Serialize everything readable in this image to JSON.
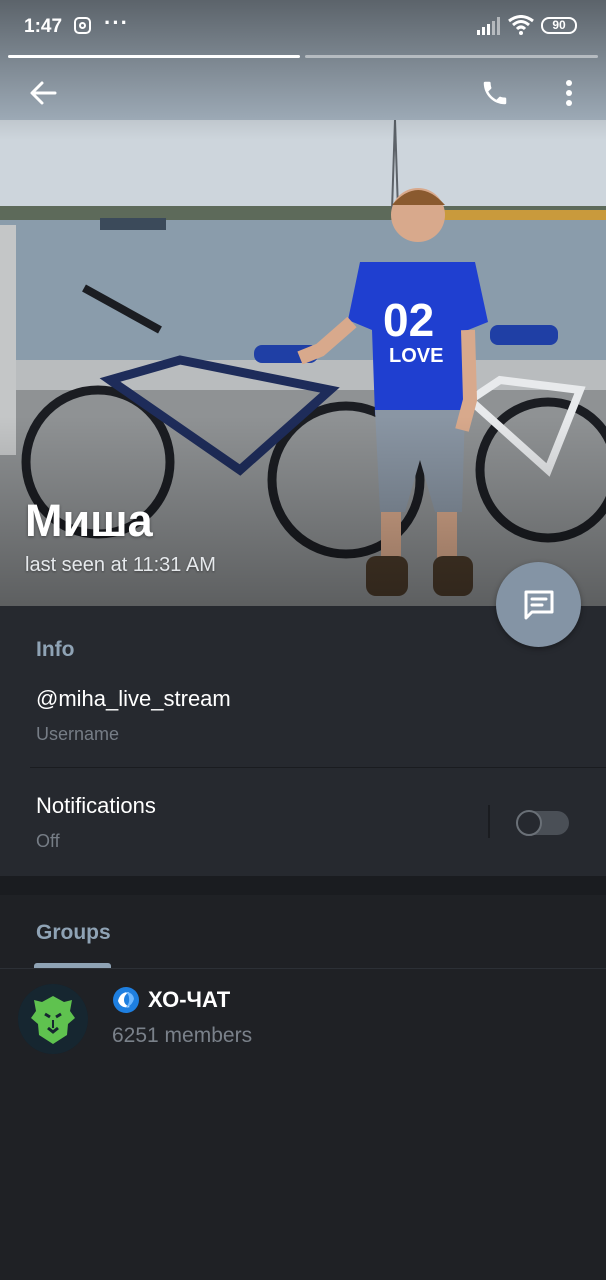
{
  "status_bar": {
    "time": "1:47",
    "battery": "90",
    "icons": [
      "instagram-icon",
      "more-dots-icon",
      "signal-icon",
      "wifi-icon",
      "battery-icon"
    ],
    "dots": "···"
  },
  "header": {
    "story_progress": {
      "segments": 2,
      "active": 1
    },
    "name": "Миша",
    "status": "last seen at 11:31 AM",
    "actions": [
      "back-arrow-icon",
      "phone-icon",
      "more-vertical-icon"
    ]
  },
  "fab": {
    "icon": "message-icon"
  },
  "info": {
    "section_title": "Info",
    "username_value": "@miha_live_stream",
    "username_label": "Username",
    "notifications_label": "Notifications",
    "notifications_value": "Off",
    "notifications_enabled": false
  },
  "groups": {
    "tab_label": "Groups",
    "items": [
      {
        "name": "ХО-ЧАТ",
        "members": "6251 members",
        "verified": true,
        "avatar_icon": "lion-logo-icon"
      }
    ]
  },
  "colors": {
    "background": "#1f2125",
    "section_bg": "#26292f",
    "accent": "#8fa3b5",
    "fab": "#8494a5",
    "secondary_text": "#767d86"
  }
}
